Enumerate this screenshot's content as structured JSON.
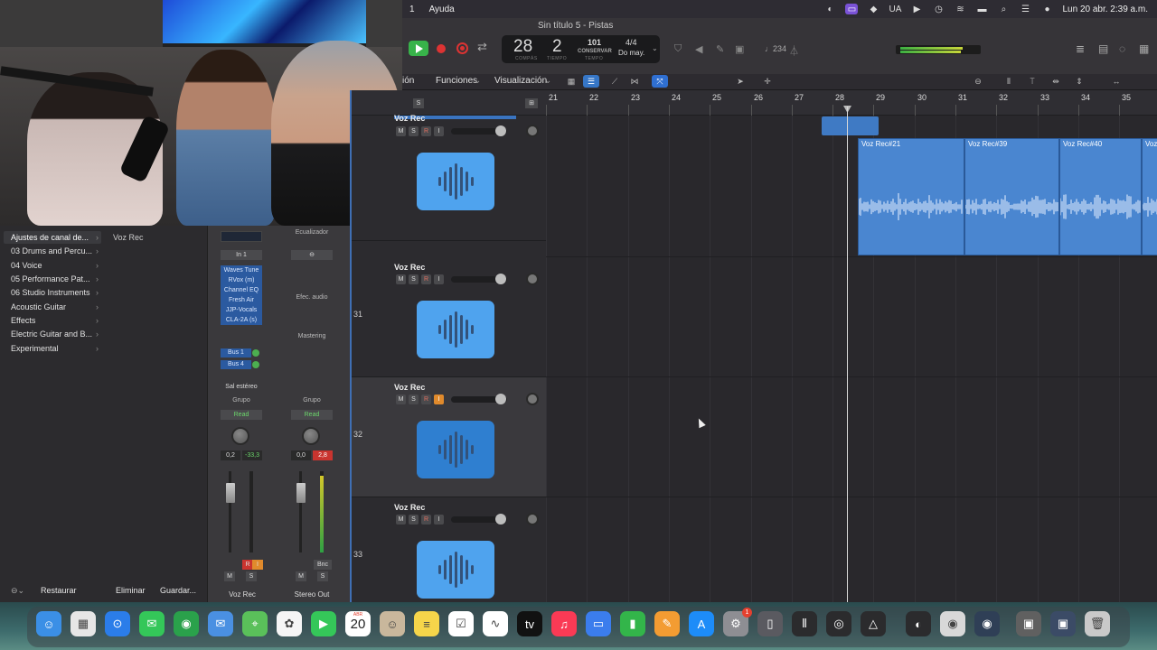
{
  "menubar": {
    "items": [
      "1",
      "Ayuda"
    ],
    "language": "UA",
    "clock": "Lun 20 abr.  2:39 a.m."
  },
  "window": {
    "title": "Sin título 5 - Pistas"
  },
  "transport": {
    "bar": "28",
    "beat": "2",
    "bar_label": "COMPÁS",
    "beat_label": "TIEMPO",
    "tempo": "101",
    "keep_label": "CONSERVAR",
    "tempo_label": "TEMPO",
    "time_signature": "4/4",
    "key": "Do may.",
    "count_in": "♩234"
  },
  "tracks_menu": {
    "items": [
      "ión",
      "Funciones",
      "Visualización"
    ]
  },
  "library": {
    "items": [
      {
        "label": "Ajustes de canal de..."
      },
      {
        "label": "03 Drums and Percu..."
      },
      {
        "label": "04 Voice"
      },
      {
        "label": "05 Performance Pat..."
      },
      {
        "label": "06 Studio Instruments"
      },
      {
        "label": "Acoustic Guitar"
      },
      {
        "label": "Effects"
      },
      {
        "label": "Electric Guitar and B..."
      },
      {
        "label": "Experimental"
      }
    ],
    "selected_patch": "Voz Rec",
    "footer": {
      "revert": "Restaurar",
      "delete": "Eliminar",
      "save": "Guardar..."
    }
  },
  "inspector": {
    "strip1": {
      "input": "In 1",
      "plugins": [
        "Waves Tune",
        "RVox (m)",
        "Channel EQ",
        "Fresh Air",
        "JJP-Vocals",
        "CLA-2A (s)"
      ],
      "sends": [
        "Bus 1",
        "Bus 4"
      ],
      "output": "Sal estéreo",
      "group": "Grupo",
      "automation": "Read",
      "volume": "0,2",
      "peak": "-33,3",
      "mute": "M",
      "solo": "S",
      "name": "Voz Rec"
    },
    "strip2": {
      "eq_label": "Ecualizador",
      "fx_label": "Efec. audio",
      "mastering_label": "Mastering",
      "group": "Grupo",
      "automation": "Read",
      "volume": "0,0",
      "peak": "2,8",
      "bounce": "Bnc",
      "mute": "M",
      "solo": "S",
      "name": "Stereo Out"
    }
  },
  "tracks": [
    {
      "number": "",
      "name": "Voz Rec",
      "mute": "M",
      "solo": "S",
      "record": "R",
      "input": "I",
      "volume": 0.88,
      "selected": false
    },
    {
      "number": "31",
      "name": "Voz Rec",
      "mute": "M",
      "solo": "S",
      "record": "R",
      "input": "I",
      "volume": 0.88,
      "selected": false
    },
    {
      "number": "32",
      "name": "Voz Rec",
      "mute": "M",
      "solo": "S",
      "record": "R",
      "input": "I",
      "volume": 0.88,
      "selected": true
    },
    {
      "number": "33",
      "name": "Voz Rec",
      "mute": "M",
      "solo": "S",
      "record": "R",
      "input": "I",
      "volume": 0.88,
      "selected": false
    }
  ],
  "header_solo": "S",
  "ruler": {
    "bars": [
      "21",
      "22",
      "23",
      "24",
      "25",
      "26",
      "27",
      "28",
      "29",
      "30",
      "31",
      "32",
      "33",
      "34",
      "35"
    ]
  },
  "regions": [
    {
      "name": "Voz Rec#21"
    },
    {
      "name": "Voz Rec#39"
    },
    {
      "name": "Voz Rec#40"
    },
    {
      "name": "Voz"
    }
  ],
  "dock": {
    "calendar_month": "ABR",
    "calendar_day": "20",
    "messages_badge": "1",
    "apps": [
      "finder-icon",
      "launchpad-icon",
      "safari-icon",
      "messages-icon",
      "chrome-icon",
      "mail-icon",
      "maps-icon",
      "photos-icon",
      "facetime-icon",
      "calendar-icon",
      "contacts-icon",
      "notes-icon",
      "reminders-icon",
      "freeform-icon",
      "tv-icon",
      "music-icon",
      "keynote-icon",
      "numbers-icon",
      "pages-icon",
      "app-store-icon",
      "system-settings-icon",
      "iphone-mirroring-icon",
      "waves-icon",
      "logic-pro-icon",
      "vectorworks-icon",
      "ai-icon",
      "record-icon",
      "obs-icon",
      "screenshot-icon",
      "photo-icon",
      "trash-icon"
    ]
  },
  "colors": {
    "accent_blue": "#4a86d0",
    "play_green": "#38b34a",
    "record_red": "#dd3333",
    "input_orange": "#e08a2c"
  }
}
